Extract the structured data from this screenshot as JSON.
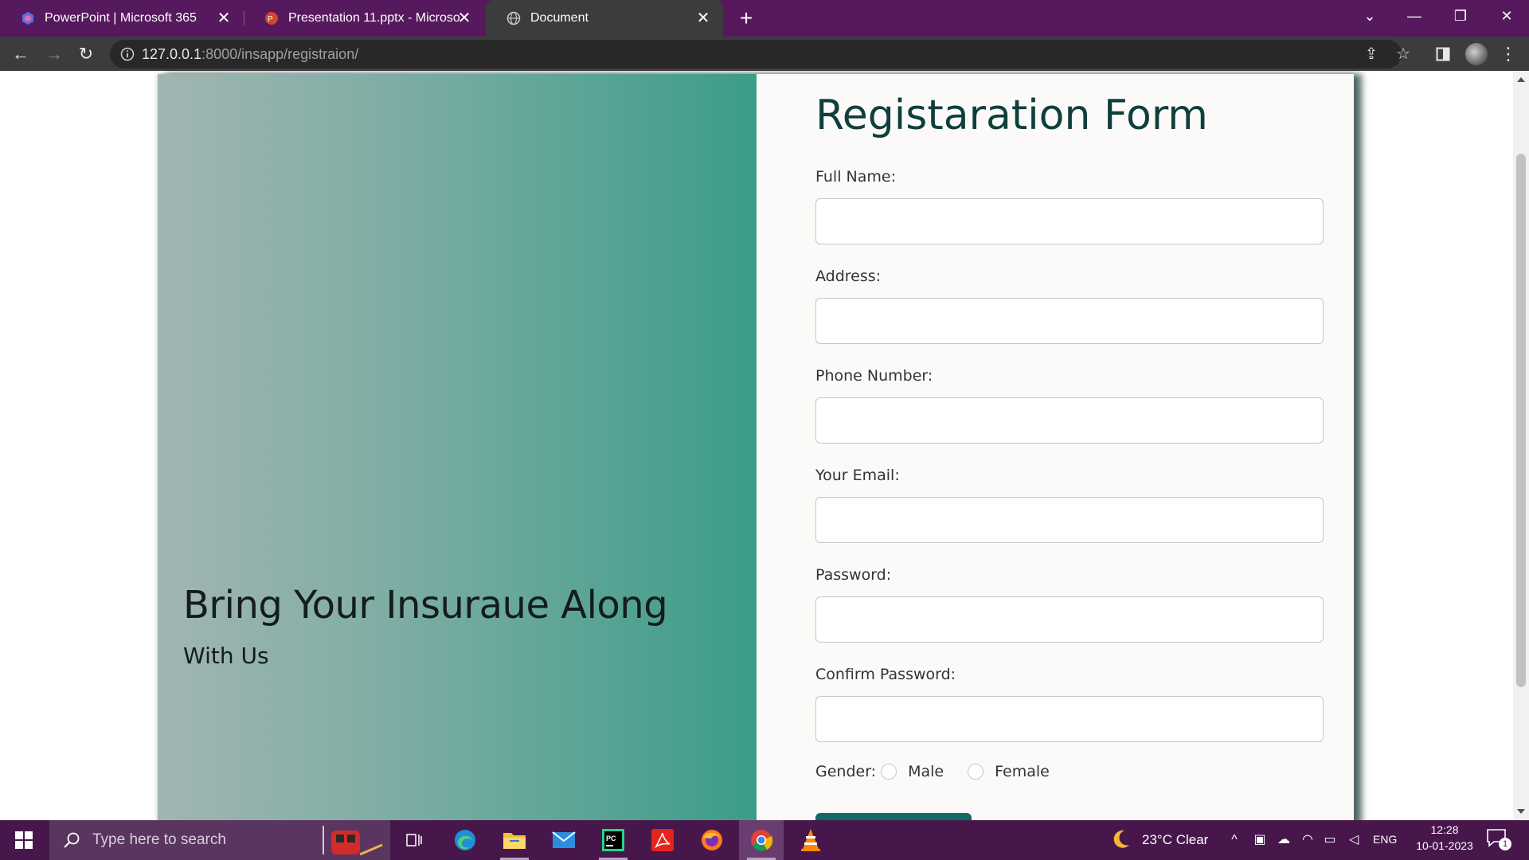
{
  "browser": {
    "tabs": [
      {
        "title": "PowerPoint | Microsoft 365",
        "icon": "microsoft365-icon"
      },
      {
        "title": "Presentation 11.pptx - Microsoft",
        "icon": "powerpoint-icon"
      },
      {
        "title": "Document",
        "icon": "globe-icon",
        "active": true
      }
    ],
    "url_host": "127.0.0.1",
    "url_rest": ":8000/insapp/registraion/"
  },
  "page": {
    "hero": {
      "headline": "Bring Your Insuraue Along",
      "subheadline": "With Us"
    },
    "form": {
      "title": "Registaration Form",
      "fields": [
        {
          "label": "Full Name:",
          "value": ""
        },
        {
          "label": "Address:",
          "value": ""
        },
        {
          "label": "Phone Number:",
          "value": ""
        },
        {
          "label": "Your Email:",
          "value": ""
        },
        {
          "label": "Password:",
          "value": ""
        },
        {
          "label": "Confirm Password:",
          "value": ""
        }
      ],
      "gender_label": "Gender:",
      "gender_options": [
        "Male",
        "Female"
      ]
    },
    "colors": {
      "hero_gradient_start": "#a2b5b2",
      "hero_gradient_end": "#3c9c8a",
      "title_color": "#0f3f3c",
      "button_color": "#0f6a63"
    }
  },
  "taskbar": {
    "search_placeholder": "Type here to search",
    "weather": "23°C  Clear",
    "language": "ENG",
    "time": "12:28",
    "date": "10-01-2023",
    "notification_count": "1"
  }
}
